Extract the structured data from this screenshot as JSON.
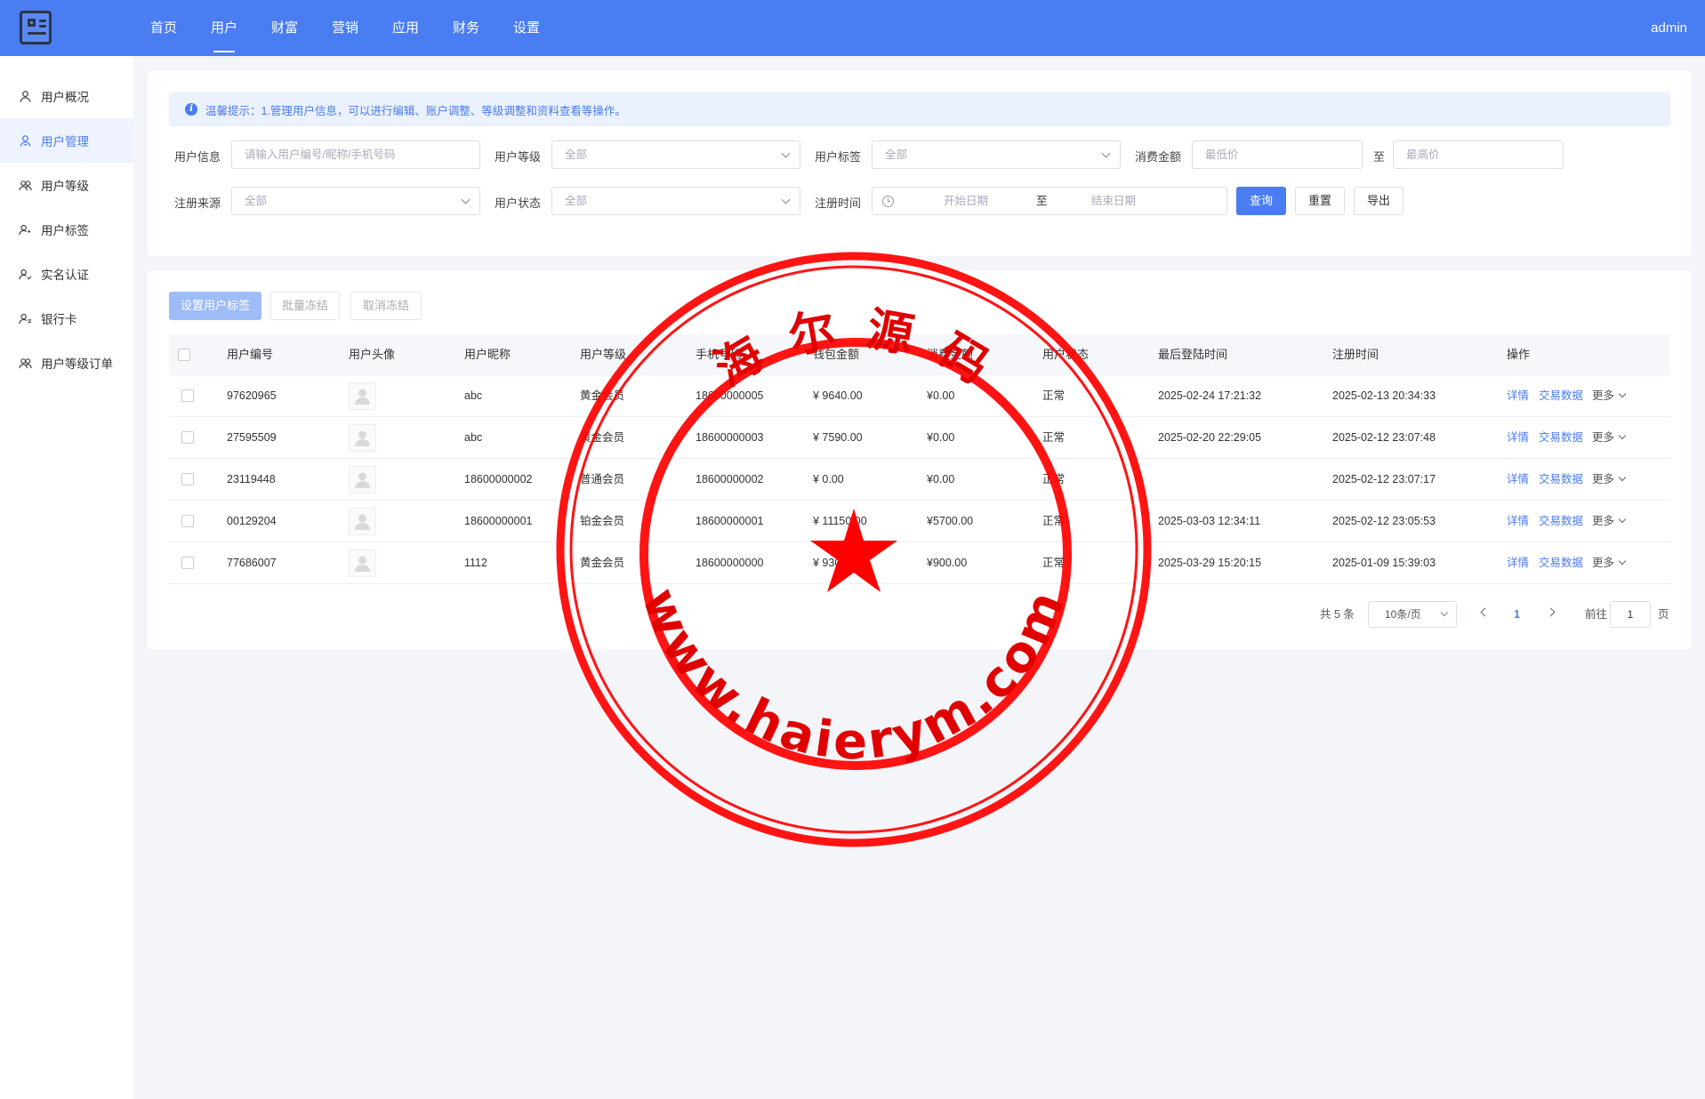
{
  "header": {
    "nav": [
      "首页",
      "用户",
      "财富",
      "营销",
      "应用",
      "财务",
      "设置"
    ],
    "active_nav": "用户",
    "user": "admin",
    "brand_color": "#4a7cf2"
  },
  "sidebar": {
    "items": [
      {
        "label": "用户概况",
        "icon": "user-icon"
      },
      {
        "label": "用户管理",
        "icon": "user-manage-icon"
      },
      {
        "label": "用户等级",
        "icon": "users-icon"
      },
      {
        "label": "用户标签",
        "icon": "user-tag-icon"
      },
      {
        "label": "实名认证",
        "icon": "user-verify-icon"
      },
      {
        "label": "银行卡",
        "icon": "user-card-icon"
      },
      {
        "label": "用户等级订单",
        "icon": "users-order-icon"
      }
    ],
    "active": "用户管理"
  },
  "filters": {
    "tip": "温馨提示：1.管理用户信息，可以进行编辑、账户调整、等级调整和资料查看等操作。",
    "user_info_label": "用户信息",
    "user_info_placeholder": "请输入用户编号/昵称/手机号码",
    "user_level_label": "用户等级",
    "user_level_value": "全部",
    "user_tag_label": "用户标签",
    "user_tag_value": "全部",
    "spend_label": "消费金额",
    "spend_min_placeholder": "最低价",
    "spend_to": "至",
    "spend_max_placeholder": "最高价",
    "reg_source_label": "注册来源",
    "reg_source_value": "全部",
    "user_status_label": "用户状态",
    "user_status_value": "全部",
    "reg_time_label": "注册时间",
    "start_date_placeholder": "开始日期",
    "date_to": "至",
    "end_date_placeholder": "结束日期",
    "query_btn": "查询",
    "reset_btn": "重置",
    "export_btn": "导出"
  },
  "toolbar": {
    "set_tag": "设置用户标签",
    "batch_freeze": "批量冻结",
    "cancel_freeze": "取消冻结"
  },
  "table": {
    "columns": [
      "用户编号",
      "用户头像",
      "用户昵称",
      "用户等级",
      "手机号码",
      "钱包金额",
      "消费金额",
      "用户状态",
      "最后登陆时间",
      "注册时间",
      "操作"
    ],
    "rows": [
      {
        "id": "97620965",
        "nickname": "abc",
        "level": "黄金会员",
        "phone": "18600000005",
        "wallet": "¥ 9640.00",
        "spent": "¥0.00",
        "status": "正常",
        "last_login": "2025-02-24 17:21:32",
        "reg_time": "2025-02-13 20:34:33"
      },
      {
        "id": "27595509",
        "nickname": "abc",
        "level": "黄金会员",
        "phone": "18600000003",
        "wallet": "¥ 7590.00",
        "spent": "¥0.00",
        "status": "正常",
        "last_login": "2025-02-20 22:29:05",
        "reg_time": "2025-02-12 23:07:48"
      },
      {
        "id": "23119448",
        "nickname": "18600000002",
        "level": "普通会员",
        "phone": "18600000002",
        "wallet": "¥ 0.00",
        "spent": "¥0.00",
        "status": "正常",
        "last_login": "",
        "reg_time": "2025-02-12 23:07:17"
      },
      {
        "id": "00129204",
        "nickname": "18600000001",
        "level": "铂金会员",
        "phone": "18600000001",
        "wallet": "¥ 11150.00",
        "spent": "¥5700.00",
        "status": "正常",
        "last_login": "2025-03-03 12:34:11",
        "reg_time": "2025-02-12 23:05:53"
      },
      {
        "id": "77686007",
        "nickname": "1112",
        "level": "黄金会员",
        "phone": "18600000000",
        "wallet": "¥ 9300.00",
        "spent": "¥900.00",
        "status": "正常",
        "last_login": "2025-03-29 15:20:15",
        "reg_time": "2025-01-09 15:39:03"
      }
    ],
    "actions": {
      "detail": "详情",
      "trade": "交易数据",
      "more": "更多"
    }
  },
  "pagination": {
    "total": "共 5 条",
    "page_size": "10条/页",
    "current": "1",
    "goto_label": "前往",
    "goto_value": "1",
    "page_unit": "页"
  },
  "watermark": {
    "top_text": "海 尔 源 码",
    "bottom_text": "www.haierym.com",
    "color": "#ff0000"
  }
}
